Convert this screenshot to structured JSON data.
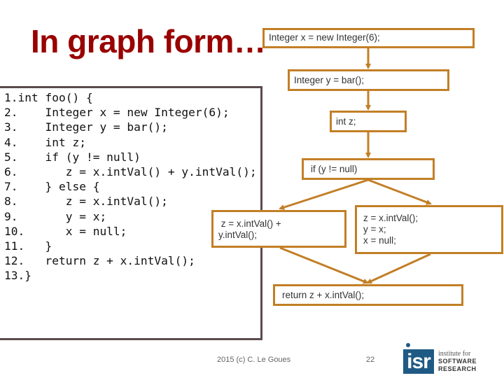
{
  "slide": {
    "title": "In graph form…",
    "code_lines": [
      "1.int foo() {",
      "2.    Integer x = new Integer(6);",
      "3.    Integer y = bar();",
      "4.    int z;",
      "5.    if (y != null)",
      "6.       z = x.intVal() + y.intVal();",
      "7.    } else {",
      "8.       z = x.intVal();",
      "9.       y = x;",
      "10.      x = null;",
      "11.   }",
      "12.   return z + x.intVal();",
      "13.}"
    ],
    "graph": {
      "edge_color": "#c27f26",
      "nodes": [
        {
          "id": "n1",
          "lines": [
            "Integer x = new Integer(6);"
          ]
        },
        {
          "id": "n2",
          "lines": [
            "Integer y = bar();"
          ]
        },
        {
          "id": "n3",
          "lines": [
            "int z;"
          ]
        },
        {
          "id": "n4",
          "lines": [
            "if (y != null)"
          ]
        },
        {
          "id": "n5",
          "lines": [
            " z = x.intVal() +",
            "y.intVal();"
          ]
        },
        {
          "id": "n6",
          "lines": [
            "z = x.intVal();",
            "y = x;",
            "x = null;"
          ]
        },
        {
          "id": "n7",
          "lines": [
            "return z + x.intVal();"
          ]
        }
      ],
      "edges": [
        {
          "from": "n1",
          "to": "n2"
        },
        {
          "from": "n2",
          "to": "n3"
        },
        {
          "from": "n3",
          "to": "n4"
        },
        {
          "from": "n4",
          "to": "n5"
        },
        {
          "from": "n4",
          "to": "n6"
        },
        {
          "from": "n5",
          "to": "n7"
        },
        {
          "from": "n6",
          "to": "n7"
        }
      ]
    },
    "footer": {
      "copyright": "2015 (c) C. Le Goues",
      "page_number": "22"
    },
    "logo": {
      "mark": "isr",
      "line1": "institute for",
      "line2": "SOFTWARE",
      "line3": "RESEARCH"
    }
  }
}
